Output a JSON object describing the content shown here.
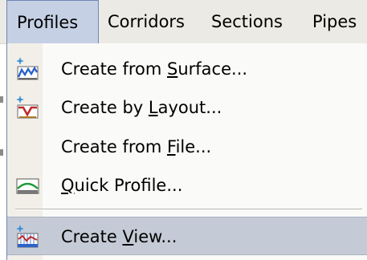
{
  "menubar": {
    "items": [
      {
        "label": "Profiles"
      },
      {
        "label": "Corridors"
      },
      {
        "label": "Sections"
      },
      {
        "label": "Pipes"
      }
    ]
  },
  "dropdown": {
    "items": [
      {
        "pre": "Create from ",
        "key": "S",
        "post": "urface...",
        "icon": "create-from-surface-icon"
      },
      {
        "pre": "Create by ",
        "key": "L",
        "post": "ayout...",
        "icon": "create-by-layout-icon"
      },
      {
        "pre": "Create from ",
        "key": "F",
        "post": "ile...",
        "icon": ""
      },
      {
        "pre": "",
        "key": "Q",
        "post": "uick Profile...",
        "icon": "quick-profile-icon"
      },
      {
        "pre": "Create ",
        "key": "V",
        "post": "iew...",
        "icon": "create-view-icon"
      }
    ]
  },
  "colors": {
    "menubar_bg": "#ebeae4",
    "active_menu_bg": "#c5d0e4",
    "highlight_bg": "#c5cbd6",
    "menu_bg": "#fafaf8"
  }
}
